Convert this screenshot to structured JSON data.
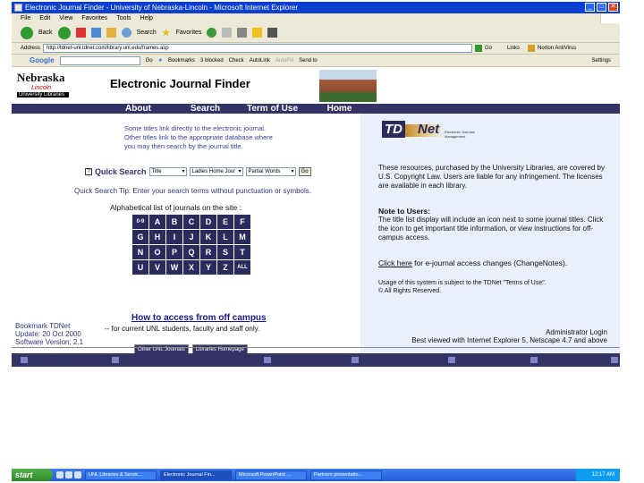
{
  "window": {
    "title": "Electronic Journal Finder - University of Nebraska-Lincoln - Microsoft Internet Explorer"
  },
  "menu": [
    "File",
    "Edit",
    "View",
    "Favorites",
    "Tools",
    "Help"
  ],
  "toolbar": {
    "back_label": "Back",
    "search_label": "Search",
    "favorites_label": "Favorites"
  },
  "addressbar": {
    "label": "Address",
    "url": "http://tdnet-unl.tdnet.com/library.unl.edu/frames.asp",
    "go_label": "Go",
    "links_label": "Links",
    "norton_label": "Norton AntiVirus"
  },
  "googlebar": {
    "google_label": "Google",
    "go_label": "Go",
    "bookmarks_label": "Bookmarks",
    "blocked_label": "3 blocked",
    "check_label": "Check",
    "autolink_label": "AutoLink",
    "autofill_label": "AutoFill",
    "sendto_label": "Send to",
    "settings_label": "Settings"
  },
  "header": {
    "logo_name": "Nebraska",
    "logo_sub": "Lincoln",
    "logo_libs": "University Libraries",
    "site_title": "Electronic Journal Finder"
  },
  "nav": [
    "About",
    "Search",
    "Term of Use",
    "Home"
  ],
  "intro": {
    "line1": "Some titles link directly to the electronic journal.",
    "line2": "Other titles link to the appropriate database where",
    "line3": "you may then search by the journal title."
  },
  "quick_search": {
    "help_label": "?",
    "label": "Quick Search",
    "field_value": "Title",
    "text_value": "Ladies Home Jour",
    "mode_value": "Partial Words",
    "go_label": "Go"
  },
  "tip": "Quick Search Tip: Enter your search terms without punctuation or symbols.",
  "alpha": {
    "title": "Alphabetical list of journals on the site :",
    "letters": [
      "0-9",
      "A",
      "B",
      "C",
      "D",
      "E",
      "F",
      "G",
      "H",
      "I",
      "J",
      "K",
      "L",
      "M",
      "N",
      "O",
      "P",
      "Q",
      "R",
      "S",
      "T",
      "U",
      "V",
      "W",
      "X",
      "Y",
      "Z",
      "ALL"
    ]
  },
  "access": {
    "link": "How to access from off campus",
    "sub": "-- for current UNL students, faculty and staff only."
  },
  "buttons": {
    "other_journals": "Other UNL Journals",
    "libraries_home": "Libraries Homepage"
  },
  "right": {
    "tdnet_logo_text": "TD",
    "tdnet_logo_rest": "Net",
    "tdnet_tagline": "Electronic Journals Management",
    "para1": "These resources, purchased by the University Libraries, are covered by U.S. Copyright Law. Users are liable for any infringement. The licenses are available in each library.",
    "note_title": "Note to Users:",
    "note_body": "The title list display will include an  icon next to some journal titles. Click the icon to get important title information, or view instructions for off-campus access.",
    "click_here": "Click here",
    "click_here_rest": " for e-journal access changes (ChangeNotes).",
    "usage": "Usage of this system is subject to the TDNet \"Terms of Use\".",
    "rights": "© All Rights Reserved."
  },
  "footer": {
    "bookmark": "Bookmark TDNet",
    "update": "Update: 20 Oct 2000",
    "version": "Software Version: 2.1",
    "admin": "Administrator Login",
    "best_viewed": "Best viewed with Internet Explorer 5, Netscape 4.7 and above"
  },
  "taskbar": {
    "start_label": "start",
    "tasks": [
      "UNL Libraries & Servic...",
      "Electronic Journal Fin...",
      "Microsoft PowerPoint ...",
      "Partners presentatio..."
    ],
    "clock": "12:17 AM"
  }
}
